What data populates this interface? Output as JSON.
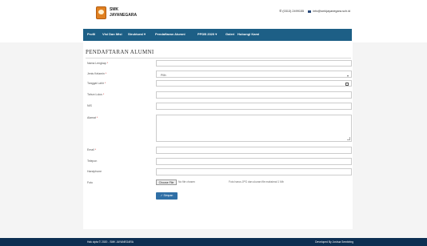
{
  "header": {
    "school_line1": "SMK",
    "school_line2": "JAYANEGARA",
    "phone": "(0313) 2499155",
    "email": "info@smkjayanegara.sch.id"
  },
  "nav": {
    "items": [
      {
        "label": "Profil"
      },
      {
        "label": "Visi Dan Misi"
      },
      {
        "label": "Struktural ▾"
      },
      {
        "label": "Pendaftaran Alumni"
      },
      {
        "label": "PPDB 2020 ▾"
      },
      {
        "label": "Galeri"
      },
      {
        "label": "Hubungi Kami"
      }
    ]
  },
  "form": {
    "title": "PENDAFTARAN ALUMNI",
    "fields": {
      "nama": "Nama Lengkap",
      "jk": "Jenis Kelamin",
      "tgl": "Tanggal Lahir",
      "tahun": "Tahun Lulus",
      "nis": "NIS",
      "alamat": "Alamat",
      "email": "Email",
      "telepon": "Telepon",
      "handphone": "Handphone",
      "foto": "Foto"
    },
    "gender_placeholder": "Pilih",
    "file_button": "Choose File",
    "file_status": "No file chosen",
    "file_hint": "Foto harus JPG dan ukuran file maksimal 1 Mb",
    "save_label": "Simpan"
  },
  "footer": {
    "copyright": "Hak cipta © 2020 - SMK JAYANEGARA",
    "developer": "Developed By Joshua Sembiring"
  },
  "colors": {
    "navbar": "#1d5f86",
    "footer": "#0d2f52",
    "button": "#2f6fa6"
  }
}
